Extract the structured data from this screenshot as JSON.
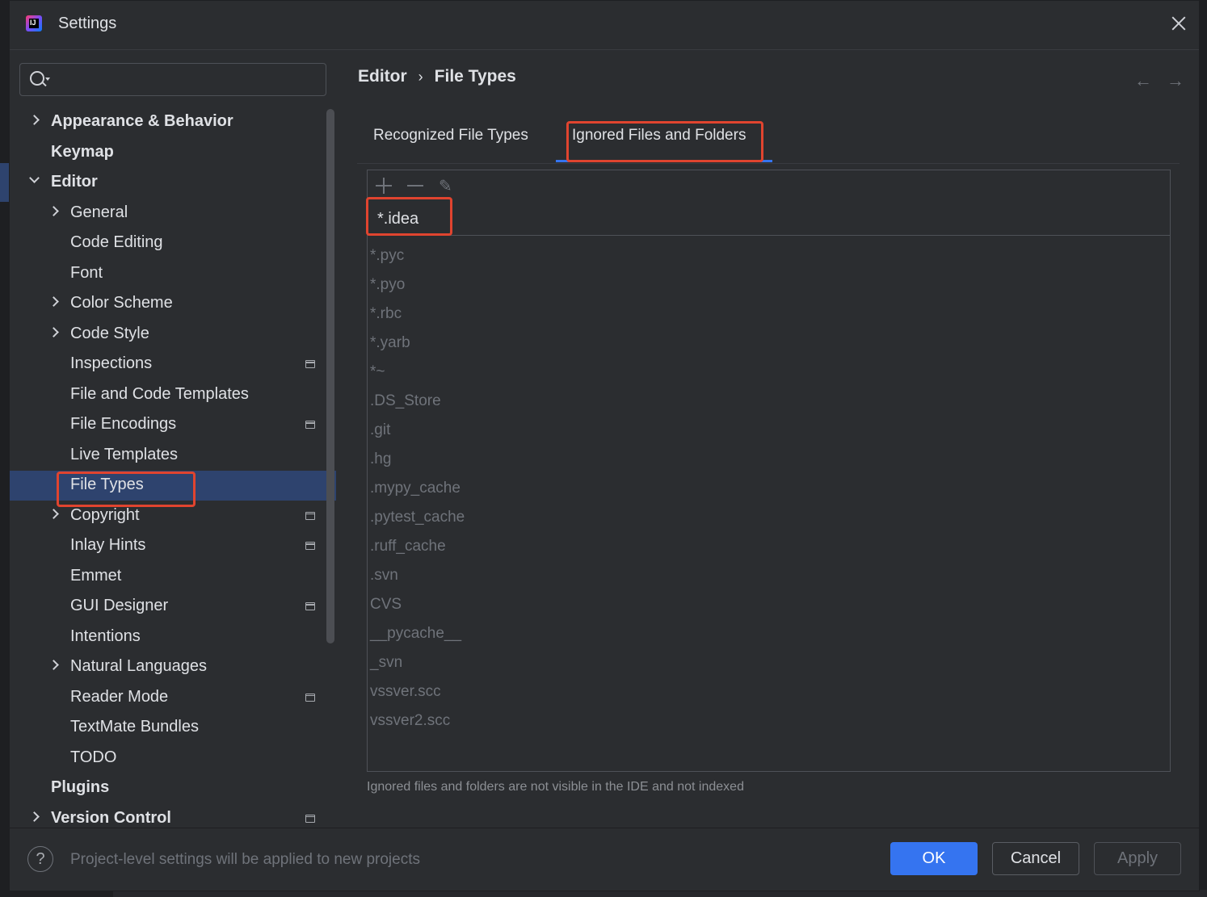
{
  "window": {
    "title": "Settings",
    "logo_text": "IJ"
  },
  "search": {
    "placeholder": "",
    "value": ""
  },
  "tree": {
    "items": [
      {
        "label": "Appearance & Behavior",
        "bold": true,
        "expander": "collapsed"
      },
      {
        "label": "Keymap",
        "bold": true,
        "expander": "none"
      },
      {
        "label": "Editor",
        "bold": true,
        "expander": "expanded"
      },
      {
        "label": "General",
        "expander": "collapsed"
      },
      {
        "label": "Code Editing",
        "expander": "none"
      },
      {
        "label": "Font",
        "expander": "none"
      },
      {
        "label": "Color Scheme",
        "expander": "collapsed"
      },
      {
        "label": "Code Style",
        "expander": "collapsed"
      },
      {
        "label": "Inspections",
        "expander": "none",
        "project_icon": true
      },
      {
        "label": "File and Code Templates",
        "expander": "none"
      },
      {
        "label": "File Encodings",
        "expander": "none",
        "project_icon": true
      },
      {
        "label": "Live Templates",
        "expander": "none"
      },
      {
        "label": "File Types",
        "expander": "none",
        "selected": true
      },
      {
        "label": "Copyright",
        "expander": "collapsed",
        "project_icon": true
      },
      {
        "label": "Inlay Hints",
        "expander": "none",
        "project_icon": true
      },
      {
        "label": "Emmet",
        "expander": "none"
      },
      {
        "label": "GUI Designer",
        "expander": "none",
        "project_icon": true
      },
      {
        "label": "Intentions",
        "expander": "none"
      },
      {
        "label": "Natural Languages",
        "expander": "collapsed"
      },
      {
        "label": "Reader Mode",
        "expander": "none",
        "project_icon": true
      },
      {
        "label": "TextMate Bundles",
        "expander": "none"
      },
      {
        "label": "TODO",
        "expander": "none"
      },
      {
        "label": "Plugins",
        "bold": true,
        "expander": "none"
      },
      {
        "label": "Version Control",
        "bold": true,
        "expander": "collapsed",
        "project_icon": true
      }
    ]
  },
  "breadcrumb": {
    "parent": "Editor",
    "separator": "›",
    "current": "File Types"
  },
  "nav": {
    "back": "←",
    "forward": "→"
  },
  "tabs": [
    {
      "label": "Recognized File Types",
      "active": false
    },
    {
      "label": "Ignored Files and Folders",
      "active": true
    }
  ],
  "toolbar": {
    "add": "add-icon",
    "remove": "remove-icon",
    "edit": "✎"
  },
  "editing_value": "*.idea",
  "patterns": [
    "*.pyc",
    "*.pyo",
    "*.rbc",
    "*.yarb",
    "*~",
    ".DS_Store",
    ".git",
    ".hg",
    ".mypy_cache",
    ".pytest_cache",
    ".ruff_cache",
    ".svn",
    "CVS",
    "__pycache__",
    "_svn",
    "vssver.scc",
    "vssver2.scc"
  ],
  "hint": "Ignored files and folders are not visible in the IDE and not indexed",
  "footer": {
    "help": "?",
    "note": "Project-level settings will be applied to new projects",
    "ok": "OK",
    "cancel": "Cancel",
    "apply": "Apply"
  },
  "colors": {
    "background": "#2b2d30",
    "selection": "#2e436e",
    "accent": "#3574f0",
    "highlight": "#e0442f"
  }
}
